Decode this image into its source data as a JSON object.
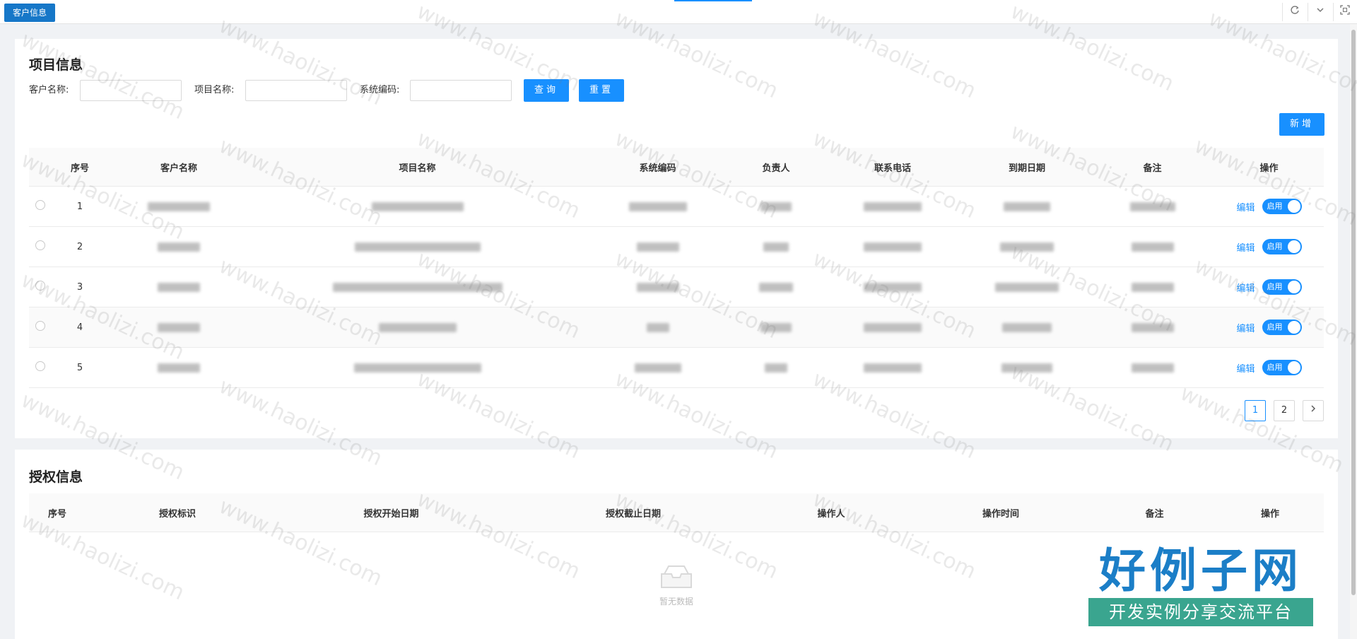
{
  "tab_bar": {
    "active_tab": "客户信息",
    "icons": [
      "refresh-icon",
      "chevron-down-icon",
      "fullscreen-icon"
    ]
  },
  "project_section": {
    "title": "项目信息",
    "filters": [
      {
        "label": "客户名称:",
        "value": "",
        "placeholder": ""
      },
      {
        "label": "项目名称:",
        "value": "",
        "placeholder": ""
      },
      {
        "label": "系统编码:",
        "value": "",
        "placeholder": ""
      }
    ],
    "query_button": "查询",
    "reset_button": "重置",
    "add_button": "新增",
    "columns": [
      "序号",
      "客户名称",
      "项目名称",
      "系统编码",
      "负责人",
      "联系电话",
      "到期日期",
      "备注",
      "操作"
    ],
    "rows": [
      {
        "index": "1",
        "edit": "编辑",
        "toggle": "启用"
      },
      {
        "index": "2",
        "edit": "编辑",
        "toggle": "启用"
      },
      {
        "index": "3",
        "edit": "编辑",
        "toggle": "启用"
      },
      {
        "index": "4",
        "edit": "编辑",
        "toggle": "启用"
      },
      {
        "index": "5",
        "edit": "编辑",
        "toggle": "启用"
      }
    ],
    "pagination": {
      "pages": [
        "1",
        "2"
      ],
      "current": "1",
      "next_icon": "chevron-right-icon"
    }
  },
  "auth_section": {
    "title": "授权信息",
    "columns": [
      "序号",
      "授权标识",
      "授权开始日期",
      "授权截止日期",
      "操作人",
      "操作时间",
      "备注",
      "操作"
    ],
    "empty_text": "暂无数据"
  },
  "watermark": {
    "text": "www.haolizi.com"
  },
  "logo": {
    "title": "好例子网",
    "subtitle": "开发实例分享交流平台"
  },
  "colors": {
    "primary": "#1890ff",
    "tab": "#1677c8",
    "logo_blue": "#1b7ec7",
    "logo_green": "#3aa58f"
  }
}
